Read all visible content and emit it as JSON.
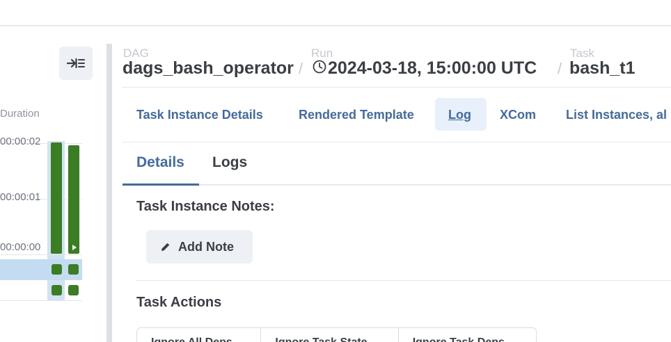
{
  "grid": {
    "duration_label": "Duration",
    "ticks": [
      "00:00:02",
      "00:00:01",
      "00:00:00"
    ],
    "collapse_icon": "collapse-right-icon"
  },
  "breadcrumb": {
    "dag_label": "DAG",
    "dag_value": "dags_bash_operator",
    "run_label": "Run",
    "run_value": "2024-03-18, 15:00:00 UTC",
    "task_label": "Task",
    "task_value": "bash_t1",
    "separator": "/"
  },
  "tabs": [
    {
      "label": "Task Instance Details"
    },
    {
      "label": "Rendered Template"
    },
    {
      "label": "Log",
      "active": true
    },
    {
      "label": "XCom"
    },
    {
      "label": "List Instances, al"
    }
  ],
  "subtabs": [
    {
      "label": "Details",
      "active": true
    },
    {
      "label": "Logs"
    }
  ],
  "notes": {
    "title": "Task Instance Notes:",
    "add_button": "Add Note"
  },
  "actions": {
    "title": "Task Actions",
    "buttons": [
      "Ignore All Deps",
      "Ignore Task State",
      "Ignore Task Deps"
    ]
  },
  "colors": {
    "accent": "#3f6ca8",
    "success": "#3a7d22"
  }
}
